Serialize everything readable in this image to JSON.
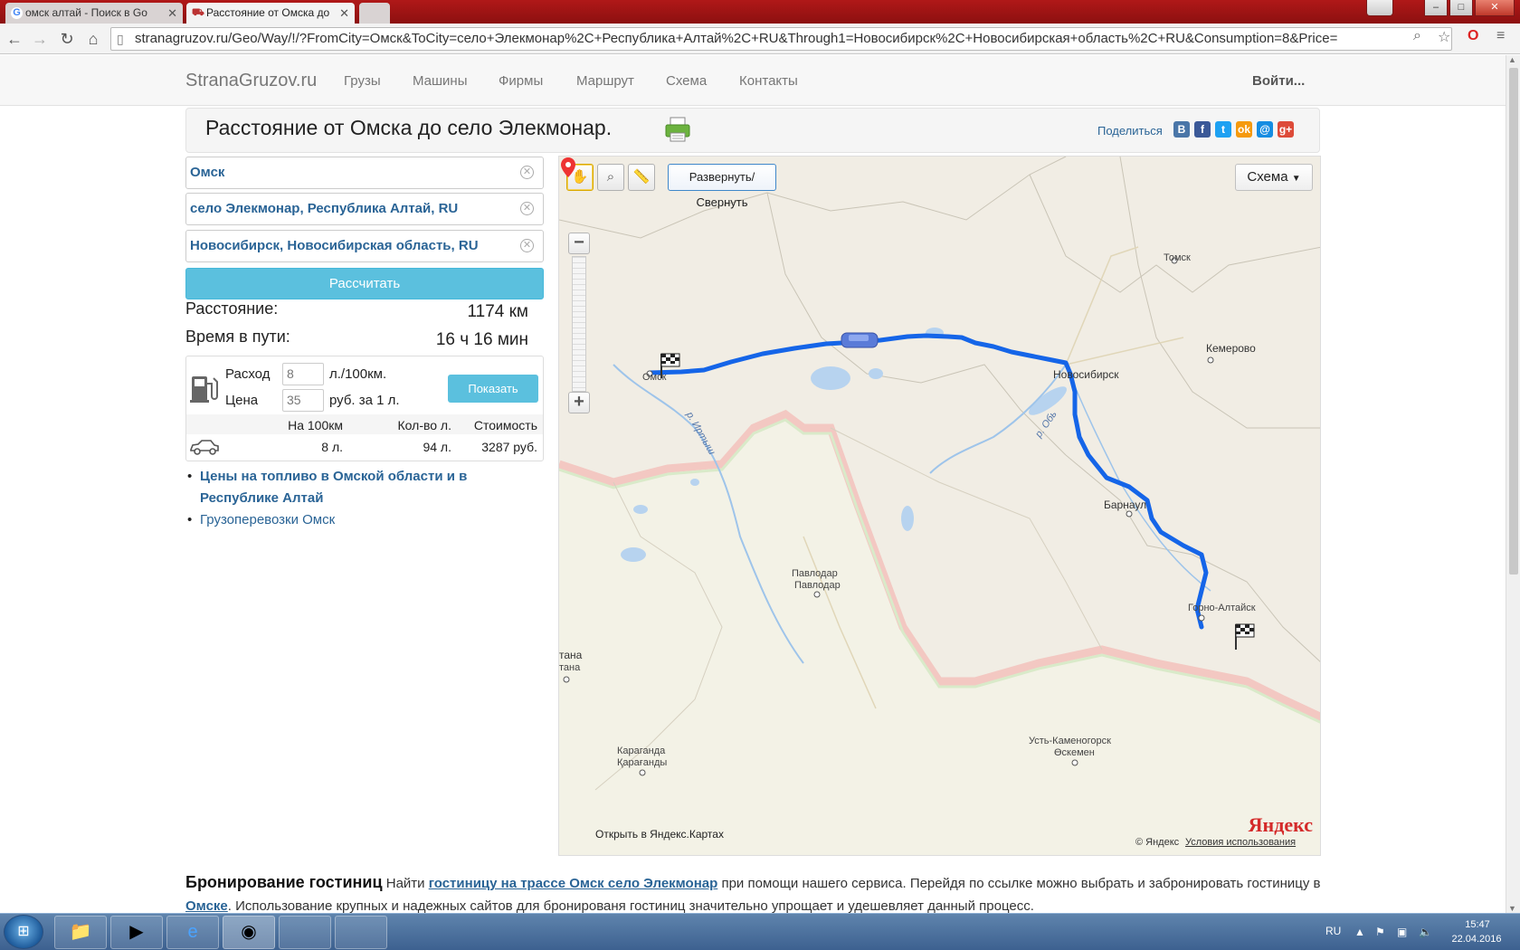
{
  "browser": {
    "tabs": [
      {
        "title": "омск алтай - Поиск в Go",
        "favicon": "google-g-icon"
      },
      {
        "title": "Расстояние от Омска до",
        "favicon": "truck-favicon-icon"
      }
    ],
    "url": "stranagruzov.ru/Geo/Way/!/?FromCity=Омск&ToCity=село+Элекмонар%2C+Республика+Алтай%2C+RU&Through1=Новосибирск%2C+Новосибирская+область%2C+RU&Consumption=8&Price="
  },
  "site": {
    "brand": "StranaGruzov.ru",
    "nav": [
      "Грузы",
      "Машины",
      "Фирмы",
      "Маршрут",
      "Схема",
      "Контакты"
    ],
    "login": "Войти..."
  },
  "heading": {
    "title": "Расстояние от Омска до село Элекмонар.",
    "share": "Поделиться"
  },
  "form": {
    "from": "Омск",
    "to": "село Элекмонар, Республика Алтай, RU",
    "through": "Новосибирск, Новосибирская область, RU",
    "calc_button": "Рассчитать"
  },
  "result": {
    "distance_label": "Расстояние:",
    "distance_value": "1174 км",
    "time_label": "Время в пути:",
    "time_value": "16 ч 16 мин"
  },
  "fuel": {
    "consumption_label": "Расход",
    "consumption_value": "8",
    "consumption_unit": "л./100км.",
    "price_label": "Цена",
    "price_value": "35",
    "price_unit": "руб. за 1 л.",
    "show_button": "Показать",
    "headers": [
      "На 100км",
      "Кол-во л.",
      "Стоимость"
    ],
    "row": [
      "8 л.",
      "94 л.",
      "3287 руб."
    ]
  },
  "links": {
    "fuel_prices": "Цены на топливо в Омской области и в Республике Алтай",
    "cargo": "Грузоперевозки Омск"
  },
  "map": {
    "expand_button": "Развернуть/Свернуть",
    "scheme_button": "Схема",
    "labels": {
      "omsk": "Омск",
      "novosibirsk": "Новосибирск",
      "tomsk": "Томск",
      "kemerovo": "Кемерово",
      "barnaul": "Барнаул",
      "gorno_altaysk": "Горно-Алтайск",
      "pavlodar": "Павлодар",
      "pavlodar2": "Павлодар",
      "astana": "тана",
      "astana2": "тана",
      "karaganda": "Караганда",
      "karaganda2": "Қарағанды",
      "ust_kamenogorsk": "Усть-Каменогорск",
      "oskemen": "Өскемен",
      "irtysh": "р. Иртыш",
      "ob": "р. Обь"
    },
    "open_in_yandex": "Открыть в Яндекс.Картах",
    "copyright": "© Яндекс",
    "terms": "Условия использования",
    "logo": "Яндекс",
    "route_color": "#1565e8"
  },
  "hotel": {
    "heading": "Бронирование гостиниц",
    "text1": " Найти ",
    "link1": "гостиницу на трассе Омск село Элекмонар",
    "text2": " при помощи нашего сервиса. Перейдя по ссылке можно выбрать и забронировать гостиницу в ",
    "link2": "Омске",
    "text3": ". Использование крупных и надежных сайтов для бронированя гостиниц значительно упрощает и удешевляет данный процесс."
  },
  "taskbar": {
    "lang": "RU",
    "time": "15:47",
    "date": "22.04.2016"
  }
}
